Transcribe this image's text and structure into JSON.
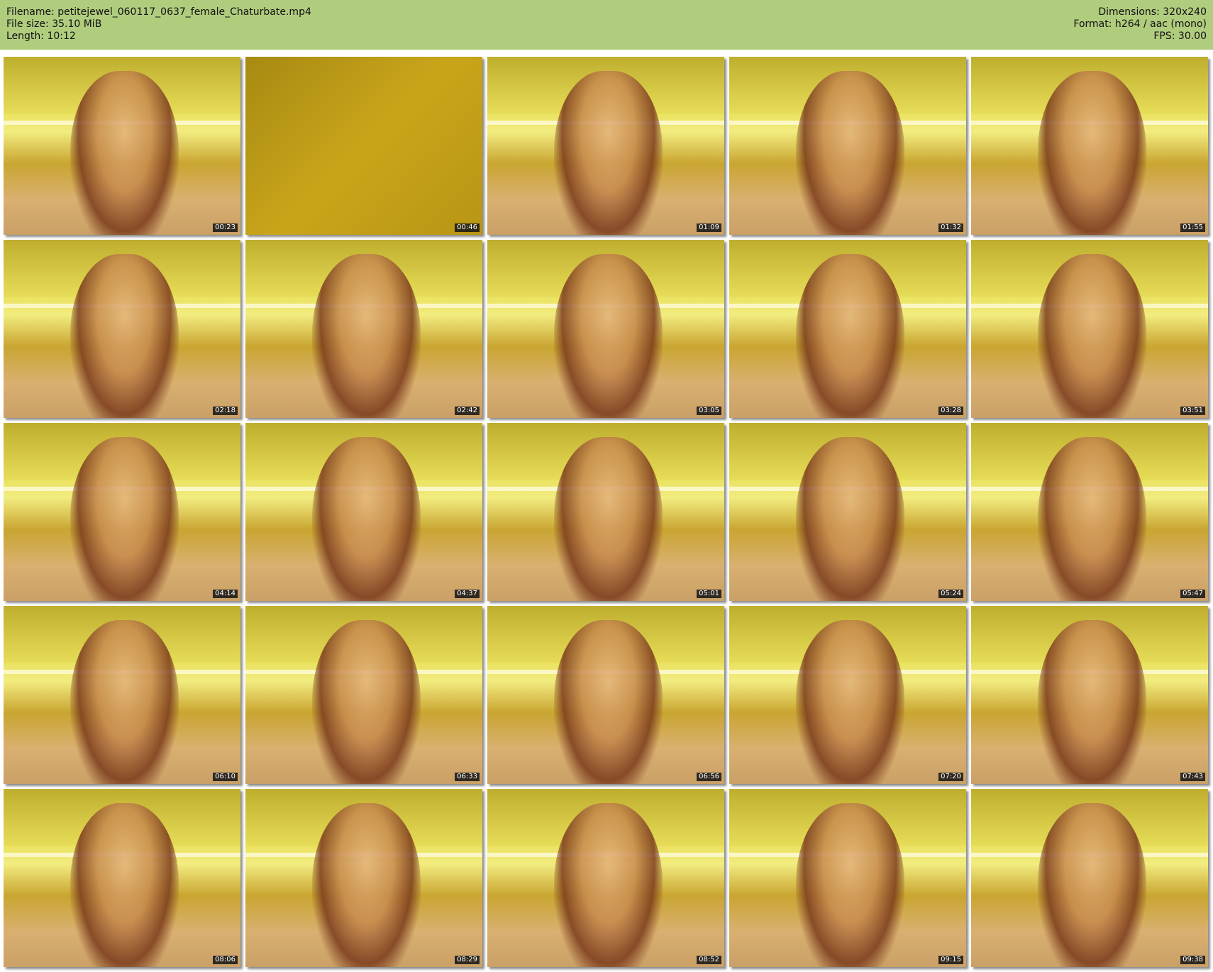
{
  "header": {
    "filename": "Filename: petitejewel_060117_0637_female_Chaturbate.mp4",
    "file_size": "File size: 35.10 MiB",
    "length": "Length: 10:12",
    "dimensions": "Dimensions: 320x240",
    "format": "Format: h264 / aac (mono)",
    "fps": "FPS: 30.00"
  },
  "thumbnails": [
    {
      "time": "00:23"
    },
    {
      "time": "00:46",
      "floor": true
    },
    {
      "time": "01:09"
    },
    {
      "time": "01:32"
    },
    {
      "time": "01:55"
    },
    {
      "time": "02:18"
    },
    {
      "time": "02:42"
    },
    {
      "time": "03:05"
    },
    {
      "time": "03:28"
    },
    {
      "time": "03:51"
    },
    {
      "time": "04:14"
    },
    {
      "time": "04:37"
    },
    {
      "time": "05:01"
    },
    {
      "time": "05:24"
    },
    {
      "time": "05:47"
    },
    {
      "time": "06:10"
    },
    {
      "time": "06:33"
    },
    {
      "time": "06:56"
    },
    {
      "time": "07:20"
    },
    {
      "time": "07:43"
    },
    {
      "time": "08:06"
    },
    {
      "time": "08:29"
    },
    {
      "time": "08:52"
    },
    {
      "time": "09:15"
    },
    {
      "time": "09:38"
    }
  ]
}
